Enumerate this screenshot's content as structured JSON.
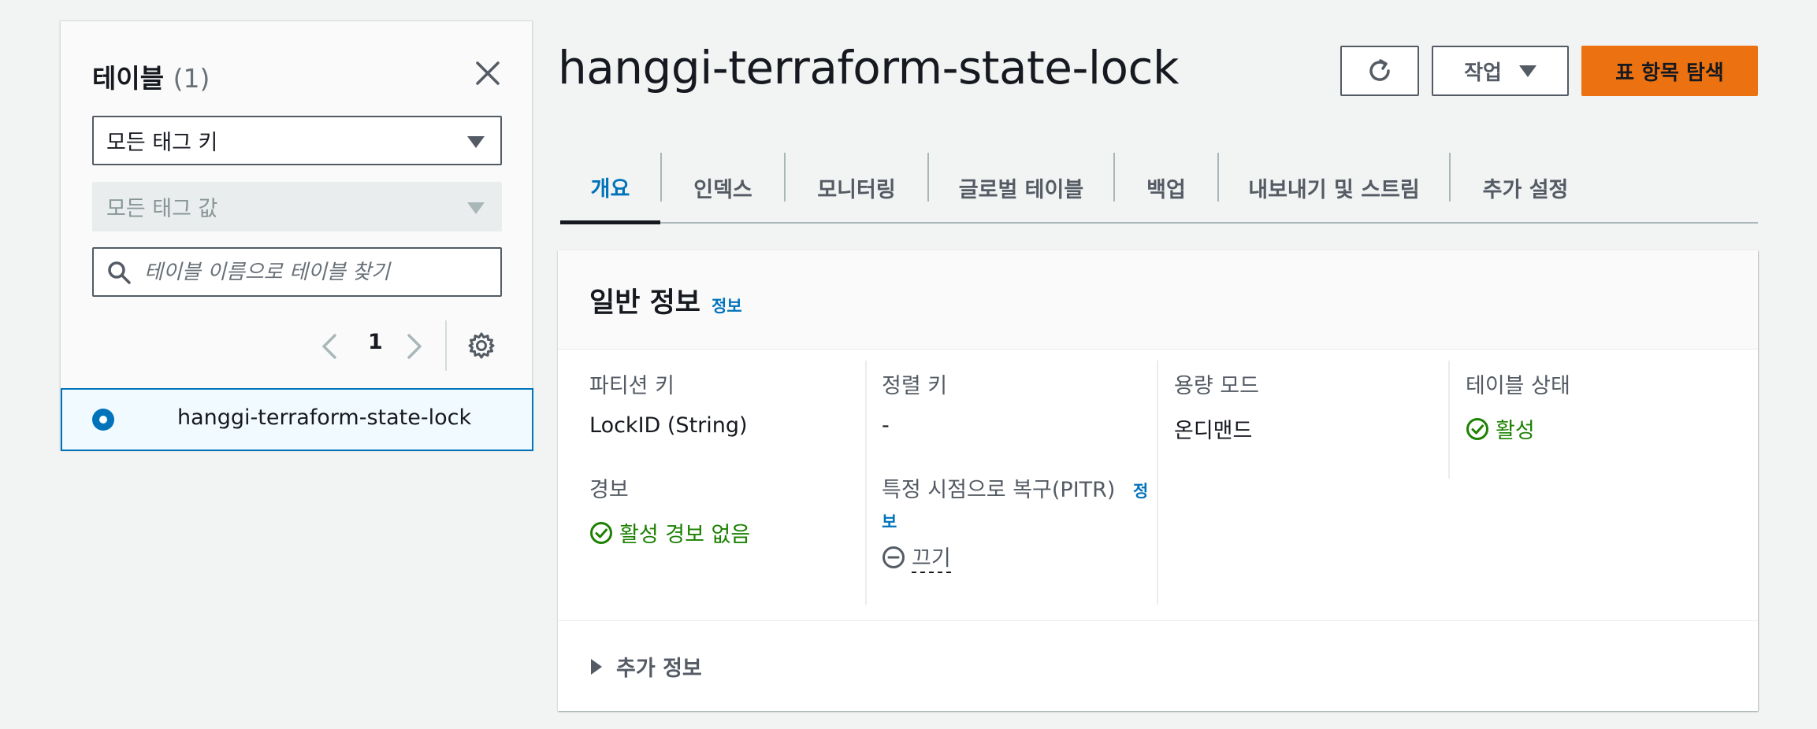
{
  "sidebar": {
    "title": "테이블",
    "count": "(1)",
    "tag_key_select": "모든 태그 키",
    "tag_value_select": "모든 태그 값",
    "search_placeholder": "테이블 이름으로 테이블 찾기",
    "page": "1",
    "tables": [
      {
        "name": "hanggi-terraform-state-lock",
        "selected": true
      }
    ]
  },
  "header": {
    "title": "hanggi-terraform-state-lock",
    "actions_label": "작업",
    "explore_label": "표 항목 탐색"
  },
  "tabs": [
    {
      "label": "개요",
      "active": true
    },
    {
      "label": "인덱스"
    },
    {
      "label": "모니터링"
    },
    {
      "label": "글로벌 테이블"
    },
    {
      "label": "백업"
    },
    {
      "label": "내보내기 및 스트림"
    },
    {
      "label": "추가 설정"
    }
  ],
  "general": {
    "title": "일반 정보",
    "info_link": "정보",
    "partition_key_label": "파티션 키",
    "partition_key_value": "LockID (String)",
    "sort_key_label": "정렬 키",
    "sort_key_value": "-",
    "capacity_label": "용량 모드",
    "capacity_value": "온디맨드",
    "status_label": "테이블 상태",
    "status_value": "활성",
    "alarms_label": "경보",
    "alarms_value": "활성 경보 없음",
    "pitr_label": "특정 시점으로 복구(PITR)",
    "pitr_info_1": "정",
    "pitr_info_2": "보",
    "pitr_value": "끄기",
    "more_info_label": "추가 정보"
  },
  "colors": {
    "accent": "#0073bb",
    "primary_button": "#ec7211",
    "success": "#1d8102",
    "background": "#f2f3f3"
  }
}
